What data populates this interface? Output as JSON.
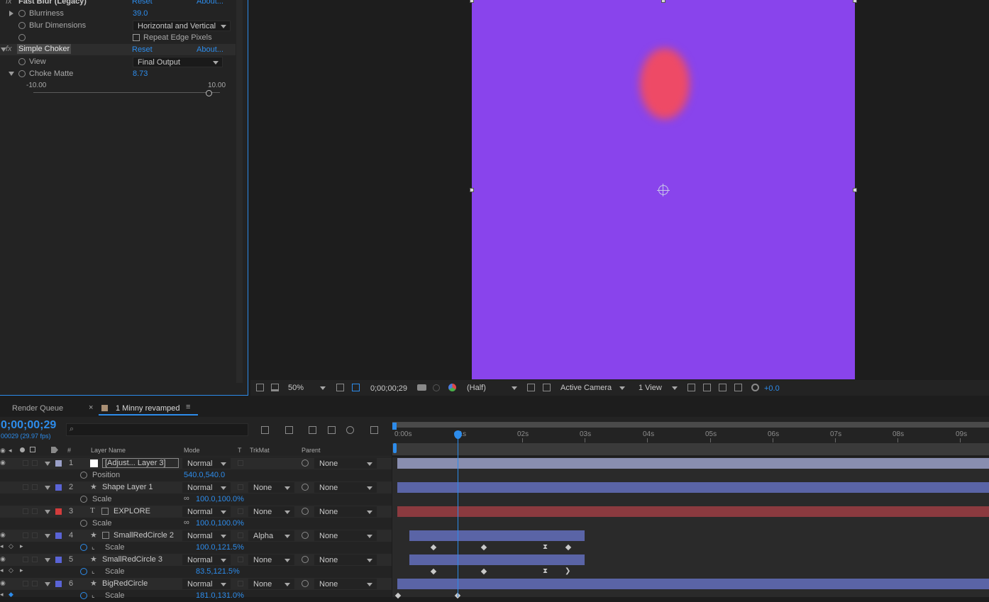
{
  "effects": {
    "fast_blur": {
      "name": "Fast Blur (Legacy)",
      "reset": "Reset",
      "about": "About...",
      "blurriness_label": "Blurriness",
      "blurriness_value": "39.0",
      "dimensions_label": "Blur Dimensions",
      "dimensions_value": "Horizontal and Vertical",
      "repeat_edge_label": "Repeat Edge Pixels"
    },
    "simple_choker": {
      "name": "Simple Choker",
      "reset": "Reset",
      "about": "About...",
      "view_label": "View",
      "view_value": "Final Output",
      "choke_label": "Choke Matte",
      "choke_value": "8.73",
      "slider_min": "-10.00",
      "slider_max": "10.00"
    }
  },
  "viewer": {
    "zoom": "50%",
    "timecode": "0;00;00;29",
    "resolution": "(Half)",
    "camera": "Active Camera",
    "views": "1 View",
    "exposure": "+0.0"
  },
  "tabs": {
    "render_queue": "Render Queue",
    "comp": "1 Minny revamped"
  },
  "timeline": {
    "timecode": "0;00;00;29",
    "frames": "00029 (29.97 fps)",
    "search_placeholder": "",
    "headers": {
      "num": "#",
      "layer_name": "Layer Name",
      "mode": "Mode",
      "t": "T",
      "trkmat": "TrkMat",
      "parent": "Parent"
    },
    "ruler": [
      "0:00s",
      "01s",
      "02s",
      "03s",
      "04s",
      "05s",
      "06s",
      "07s",
      "08s",
      "09s"
    ],
    "layers": [
      {
        "num": "1",
        "name": "[Adjust... Layer 3]",
        "mode": "Normal",
        "trkmat": "",
        "parent": "None",
        "prop": "Position",
        "prop_value": "540.0,540.0"
      },
      {
        "num": "2",
        "name": "Shape Layer 1",
        "mode": "Normal",
        "trkmat": "None",
        "parent": "None",
        "prop": "Scale",
        "prop_value": "100.0,100.0%"
      },
      {
        "num": "3",
        "name": "EXPLORE",
        "mode": "Normal",
        "trkmat": "None",
        "parent": "None",
        "prop": "Scale",
        "prop_value": "100.0,100.0%"
      },
      {
        "num": "4",
        "name": "SmallRedCircle 2",
        "mode": "Normal",
        "trkmat": "Alpha",
        "parent": "None",
        "prop": "Scale",
        "prop_value": "100.0,121.5%"
      },
      {
        "num": "5",
        "name": "SmallRedCircle 3",
        "mode": "Normal",
        "trkmat": "None",
        "parent": "None",
        "prop": "Scale",
        "prop_value": "83.5,121.5%"
      },
      {
        "num": "6",
        "name": "BigRedCircle",
        "mode": "Normal",
        "trkmat": "None",
        "parent": "None",
        "prop": "Scale",
        "prop_value": "181.0,131.0%"
      }
    ]
  },
  "colors": {
    "canvas": "#8944ec",
    "red_circle": "#ee4a66",
    "accent": "#2d8ceb",
    "layer_blue": "#5a64a6",
    "layer_red": "#8b3a3f",
    "adjust_bar": "#9aa0c8"
  }
}
